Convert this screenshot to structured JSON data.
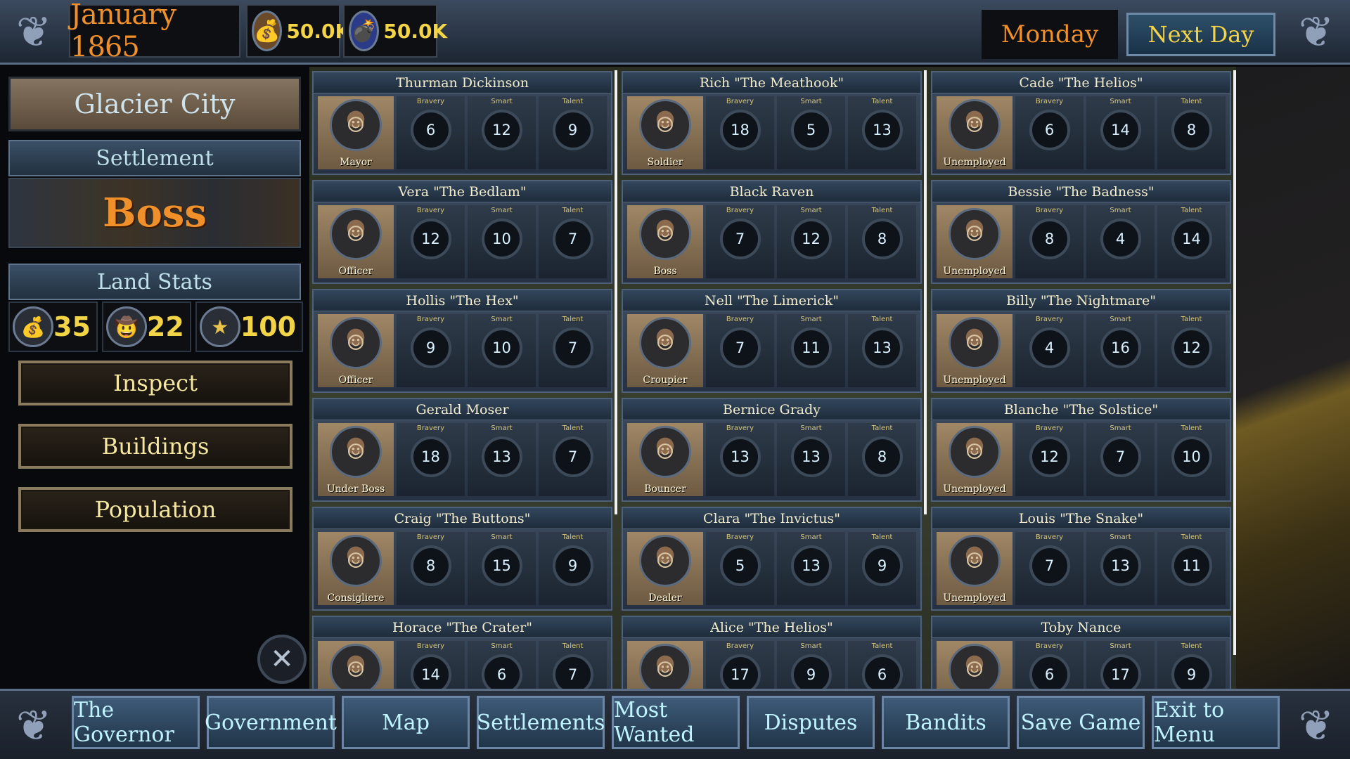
{
  "header": {
    "date": "January 1865",
    "resource1": {
      "icon": "money-bag-icon",
      "value": "50.0K"
    },
    "resource2": {
      "icon": "bomb-icon",
      "value": "50.0K"
    },
    "day": "Monday",
    "next_day_label": "Next Day"
  },
  "left": {
    "city_name": "Glacier City",
    "settlement_heading": "Settlement",
    "settlement_title": "Boss",
    "land_stats_heading": "Land Stats",
    "land_stats": [
      {
        "icon": "money-bag-icon",
        "value": "35"
      },
      {
        "icon": "bandit-face-icon",
        "value": "22"
      },
      {
        "icon": "star-icon",
        "value": "100"
      }
    ],
    "buttons": {
      "inspect": "Inspect",
      "buildings": "Buildings",
      "population": "Population"
    }
  },
  "stat_labels": {
    "bravery": "Bravery",
    "smart": "Smart",
    "talent": "Talent"
  },
  "people": [
    {
      "name": "Thurman  Dickinson",
      "role": "Mayor",
      "bravery": "6",
      "smart": "12",
      "talent": "9"
    },
    {
      "name": "Rich \"The Meathook\"",
      "role": "Soldier",
      "bravery": "18",
      "smart": "5",
      "talent": "13"
    },
    {
      "name": "Cade \"The Helios\"",
      "role": "Unemployed",
      "bravery": "6",
      "smart": "14",
      "talent": "8"
    },
    {
      "name": "Vera \"The Bedlam\"",
      "role": "Officer",
      "bravery": "12",
      "smart": "10",
      "talent": "7"
    },
    {
      "name": "Black Raven",
      "role": "Boss",
      "bravery": "7",
      "smart": "12",
      "talent": "8"
    },
    {
      "name": "Bessie \"The Badness\"",
      "role": "Unemployed",
      "bravery": "8",
      "smart": "4",
      "talent": "14"
    },
    {
      "name": "Hollis \"The Hex\"",
      "role": "Officer",
      "bravery": "9",
      "smart": "10",
      "talent": "7"
    },
    {
      "name": "Nell \"The Limerick\"",
      "role": "Croupier",
      "bravery": "7",
      "smart": "11",
      "talent": "13"
    },
    {
      "name": "Billy \"The Nightmare\"",
      "role": "Unemployed",
      "bravery": "4",
      "smart": "16",
      "talent": "12"
    },
    {
      "name": "Gerald  Moser",
      "role": "Under Boss",
      "bravery": "18",
      "smart": "13",
      "talent": "7"
    },
    {
      "name": "Bernice  Grady",
      "role": "Bouncer",
      "bravery": "13",
      "smart": "13",
      "talent": "8"
    },
    {
      "name": "Blanche \"The Solstice\"",
      "role": "Unemployed",
      "bravery": "12",
      "smart": "7",
      "talent": "10"
    },
    {
      "name": "Craig \"The Buttons\"",
      "role": "Consigliere",
      "bravery": "8",
      "smart": "15",
      "talent": "9"
    },
    {
      "name": "Clara \"The Invictus\"",
      "role": "Dealer",
      "bravery": "5",
      "smart": "13",
      "talent": "9"
    },
    {
      "name": "Louis \"The Snake\"",
      "role": "Unemployed",
      "bravery": "7",
      "smart": "13",
      "talent": "11"
    },
    {
      "name": "Horace \"The Crater\"",
      "role": "",
      "bravery": "14",
      "smart": "6",
      "talent": "7"
    },
    {
      "name": "Alice \"The Helios\"",
      "role": "",
      "bravery": "17",
      "smart": "9",
      "talent": "6"
    },
    {
      "name": "Toby  Nance",
      "role": "",
      "bravery": "6",
      "smart": "17",
      "talent": "9"
    }
  ],
  "nav": [
    "The Governor",
    "Government",
    "Map",
    "Settlements",
    "Most Wanted",
    "Disputes",
    "Bandits",
    "Save Game",
    "Exit to Menu"
  ],
  "close_icon": "close-x-icon"
}
